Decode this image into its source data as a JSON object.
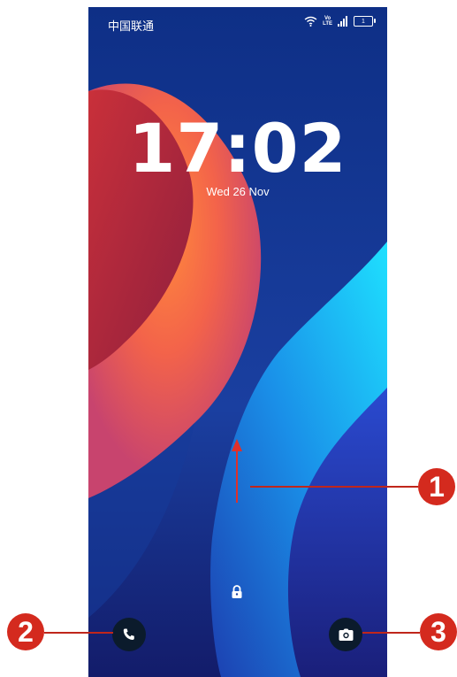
{
  "status_bar": {
    "carrier": "中国联通",
    "volte_top": "Vo",
    "volte_bottom": "LTE",
    "battery": "1"
  },
  "lock_screen": {
    "time": "17:02",
    "date": "Wed 26 Nov"
  },
  "shortcuts": {
    "left": "phone-icon",
    "right": "camera-icon"
  },
  "callouts": [
    "1",
    "2",
    "3"
  ],
  "colors": {
    "callout": "#d42a1e",
    "arrow": "#e0302a",
    "shortcut_bg": "#0b1b2c"
  }
}
